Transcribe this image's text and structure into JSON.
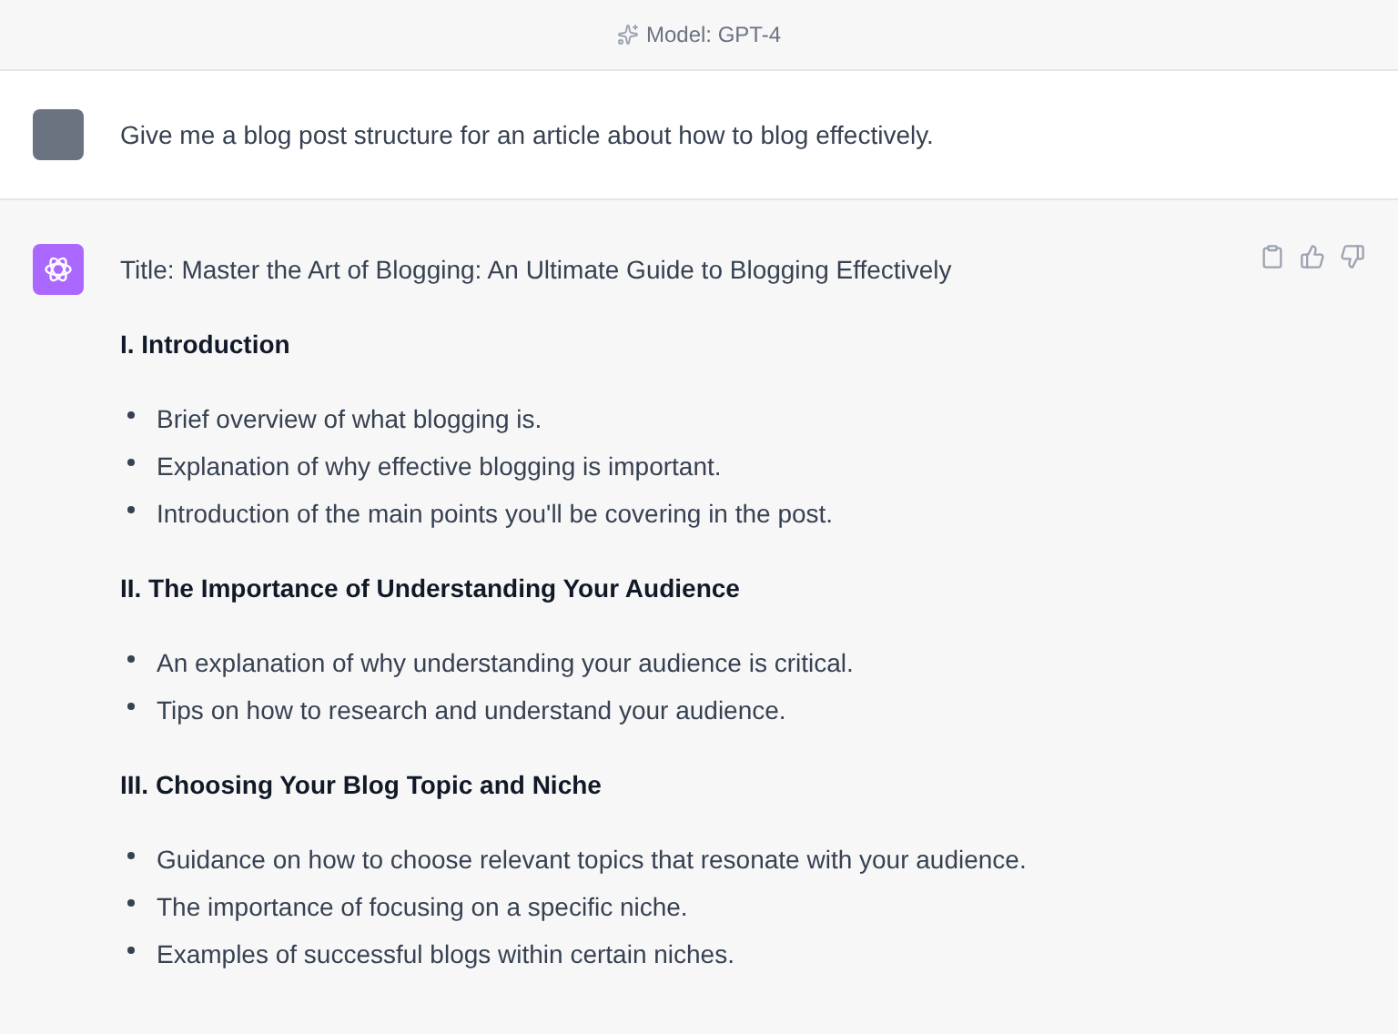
{
  "header": {
    "model_label": "Model: GPT-4"
  },
  "user_message": {
    "text": "Give me a blog post structure for an article about how to blog effectively."
  },
  "assistant_message": {
    "title": "Title: Master the Art of Blogging: An Ultimate Guide to Blogging Effectively",
    "sections": [
      {
        "heading": "I. Introduction",
        "bullets": [
          "Brief overview of what blogging is.",
          "Explanation of why effective blogging is important.",
          "Introduction of the main points you'll be covering in the post."
        ]
      },
      {
        "heading": "II. The Importance of Understanding Your Audience",
        "bullets": [
          "An explanation of why understanding your audience is critical.",
          "Tips on how to research and understand your audience."
        ]
      },
      {
        "heading": "III. Choosing Your Blog Topic and Niche",
        "bullets": [
          "Guidance on how to choose relevant topics that resonate with your audience.",
          "The importance of focusing on a specific niche.",
          "Examples of successful blogs within certain niches."
        ]
      }
    ]
  }
}
